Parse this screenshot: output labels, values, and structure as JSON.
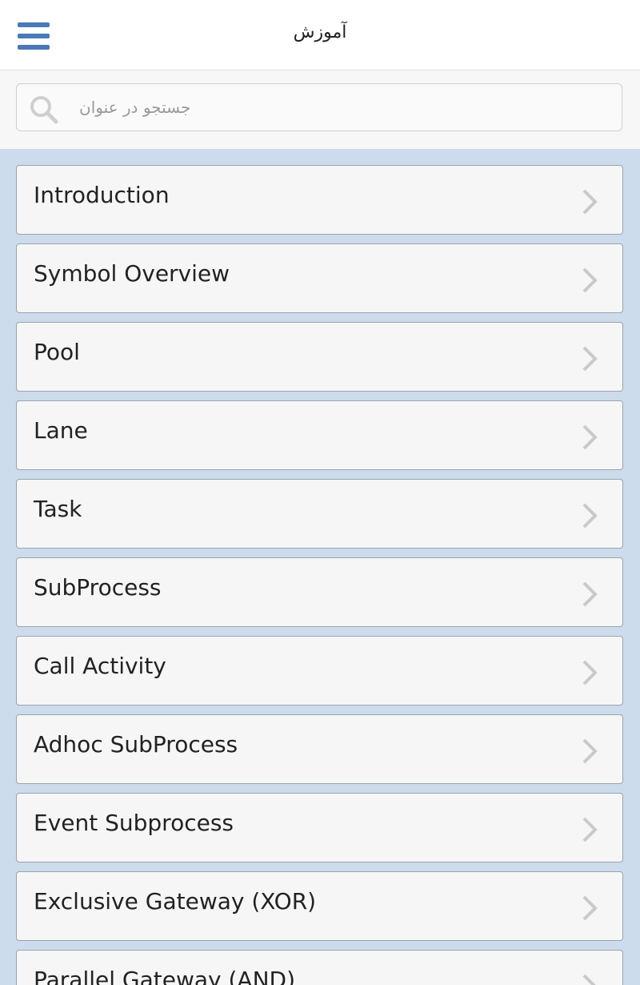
{
  "header": {
    "title": "آموزش",
    "menu_icon": "hamburger-menu-icon",
    "accent_color": "#4a7ab6"
  },
  "search": {
    "placeholder": "جستجو در عنوان",
    "value": "",
    "icon": "search-icon"
  },
  "list": {
    "background_color": "#cddcec",
    "items": [
      {
        "label": "Introduction",
        "icon": "chevron-right-icon"
      },
      {
        "label": "Symbol Overview",
        "icon": "chevron-right-icon"
      },
      {
        "label": "Pool",
        "icon": "chevron-right-icon"
      },
      {
        "label": "Lane",
        "icon": "chevron-right-icon"
      },
      {
        "label": "Task",
        "icon": "chevron-right-icon"
      },
      {
        "label": "SubProcess",
        "icon": "chevron-right-icon"
      },
      {
        "label": "Call Activity",
        "icon": "chevron-right-icon"
      },
      {
        "label": "Adhoc SubProcess",
        "icon": "chevron-right-icon"
      },
      {
        "label": "Event Subprocess",
        "icon": "chevron-right-icon"
      },
      {
        "label": "Exclusive Gateway (XOR)",
        "icon": "chevron-right-icon"
      },
      {
        "label": "Parallel Gateway (AND)",
        "icon": "chevron-right-icon"
      }
    ]
  }
}
